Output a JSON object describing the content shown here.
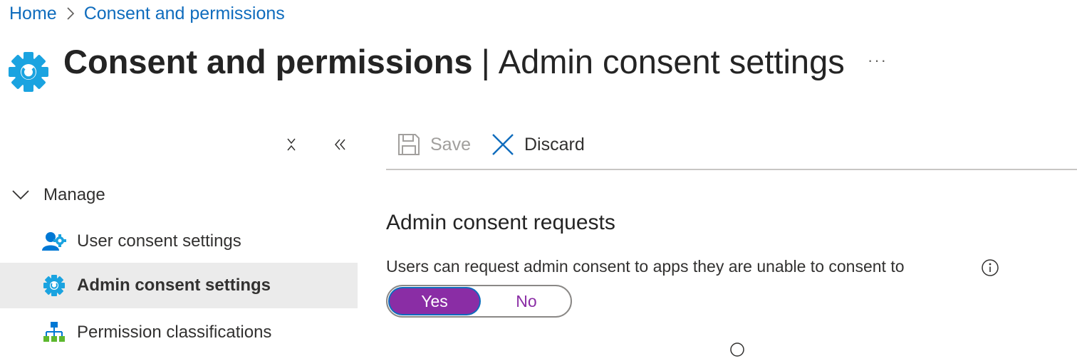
{
  "breadcrumb": {
    "home": "Home",
    "current": "Consent and permissions"
  },
  "header": {
    "title_main": "Consent and permissions",
    "title_sep": "|",
    "title_sub": "Admin consent settings",
    "more": "···"
  },
  "nav": {
    "group_label": "Manage",
    "items": [
      {
        "label": "User consent settings",
        "icon": "user-gear-icon",
        "selected": false
      },
      {
        "label": "Admin consent settings",
        "icon": "gear-icon",
        "selected": true
      },
      {
        "label": "Permission classifications",
        "icon": "org-chart-icon",
        "selected": false
      }
    ]
  },
  "toolbar": {
    "save_label": "Save",
    "discard_label": "Discard"
  },
  "content": {
    "section_title": "Admin consent requests",
    "setting_label": "Users can request admin consent to apps they are unable to consent to",
    "toggle": {
      "yes": "Yes",
      "no": "No",
      "selected": "Yes"
    }
  },
  "colors": {
    "link": "#0f6cbd",
    "gear": "#1aa3e0",
    "toggle_selected": "#8a2da5",
    "nav_selected_bg": "#ebebeb",
    "discard_icon": "#0f6cbd"
  }
}
